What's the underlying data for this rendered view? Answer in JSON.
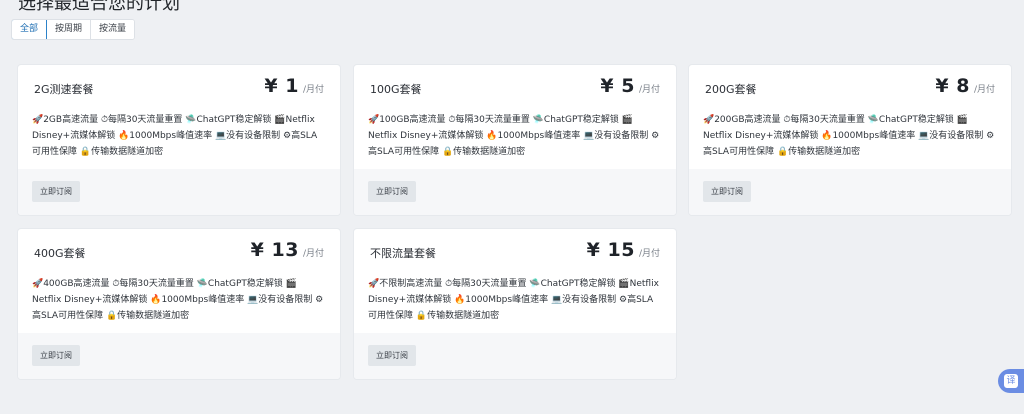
{
  "page_title": "选择最适合您的计划",
  "filters": [
    {
      "label": "全部",
      "active": true
    },
    {
      "label": "按周期",
      "active": false
    },
    {
      "label": "按流量",
      "active": false
    }
  ],
  "plans": [
    {
      "name": "2G测速套餐",
      "price": "¥ 1",
      "unit": "/月付",
      "description": "🚀2GB高速流量 ⏱每隔30天流量重置 🛸ChatGPT稳定解锁 🎬Netflix Disney+流媒体解锁 🔥1000Mbps峰值速率 💻没有设备限制 ⚙高SLA可用性保障 🔒传输数据隧道加密",
      "button": "立即订阅"
    },
    {
      "name": "100G套餐",
      "price": "¥ 5",
      "unit": "/月付",
      "description": "🚀100GB高速流量 ⏱每隔30天流量重置 🛸ChatGPT稳定解锁 🎬Netflix Disney+流媒体解锁 🔥1000Mbps峰值速率 💻没有设备限制 ⚙高SLA可用性保障 🔒传输数据隧道加密",
      "button": "立即订阅"
    },
    {
      "name": "200G套餐",
      "price": "¥ 8",
      "unit": "/月付",
      "description": "🚀200GB高速流量 ⏱每隔30天流量重置 🛸ChatGPT稳定解锁 🎬Netflix Disney+流媒体解锁 🔥1000Mbps峰值速率 💻没有设备限制 ⚙高SLA可用性保障 🔒传输数据隧道加密",
      "button": "立即订阅"
    },
    {
      "name": "400G套餐",
      "price": "¥ 13",
      "unit": "/月付",
      "description": "🚀400GB高速流量 ⏱每隔30天流量重置 🛸ChatGPT稳定解锁 🎬Netflix Disney+流媒体解锁 🔥1000Mbps峰值速率 💻没有设备限制 ⚙高SLA可用性保障 🔒传输数据隧道加密",
      "button": "立即订阅"
    },
    {
      "name": "不限流量套餐",
      "price": "¥ 15",
      "unit": "/月付",
      "description": "🚀不限制高速流量 ⏱每隔30天流量重置 🛸ChatGPT稳定解锁 🎬Netflix Disney+流媒体解锁 🔥1000Mbps峰值速率 💻没有设备限制 ⚙高SLA可用性保障 🔒传输数据隧道加密",
      "button": "立即订阅"
    }
  ],
  "translate_button": "译",
  "colors": {
    "background": "#eef0f3",
    "card": "#ffffff",
    "active_filter": "#2c82c9",
    "translate_fab": "#6b8de3"
  }
}
